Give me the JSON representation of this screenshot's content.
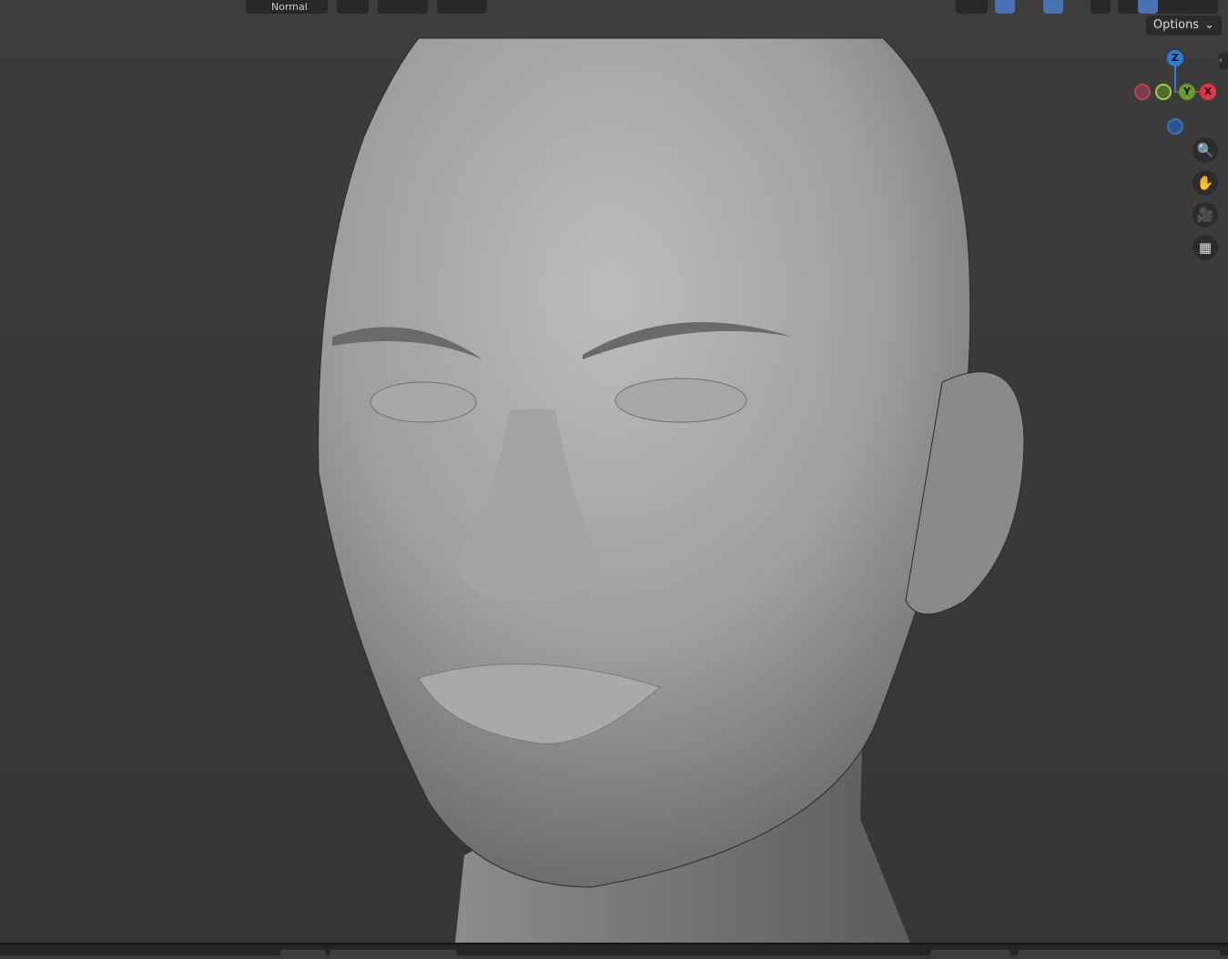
{
  "header": {
    "shading_mode": "Normal",
    "options_label": "Options"
  },
  "gizmo": {
    "axes": [
      {
        "label": "Z",
        "color": "#2f7ad8"
      },
      {
        "label": "Y",
        "color": "#6b9a2a"
      },
      {
        "label": "X",
        "color": "#e6334b"
      }
    ]
  },
  "nav": {
    "zoom_icon": "zoom-in-icon",
    "pan_icon": "hand-icon",
    "camera_icon": "camera-icon",
    "ortho_icon": "grid-icon"
  },
  "colors": {
    "accent": "#4772b3",
    "background": "#3a3a3a"
  }
}
